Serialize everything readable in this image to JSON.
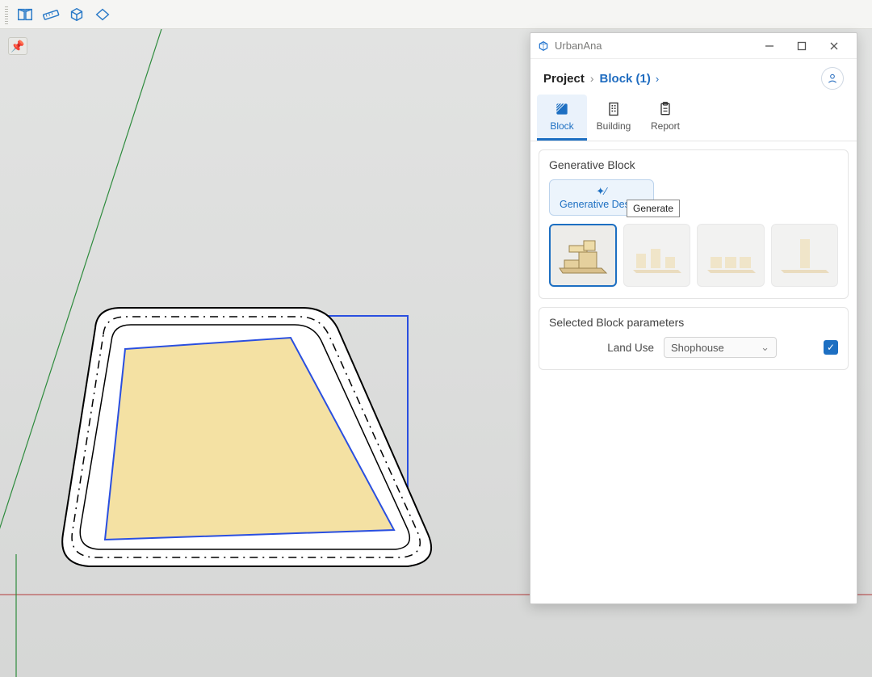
{
  "app": {
    "name": "UrbanAna"
  },
  "breadcrumbs": {
    "project": "Project",
    "block": "Block (1)"
  },
  "tabs": {
    "block": "Block",
    "building": "Building",
    "report": "Report",
    "active": "block"
  },
  "generative": {
    "section_title": "Generative Block",
    "button_label": "Generative Design",
    "tooltip": "Generate"
  },
  "params": {
    "section_title": "Selected Block parameters",
    "land_use_label": "Land Use",
    "land_use_value": "Shophouse",
    "checked": true
  },
  "toolbar_icons": [
    "book-open",
    "ruler",
    "box-3d",
    "diamond"
  ],
  "preset_names": [
    "preset-courtyard",
    "preset-scattered",
    "preset-row",
    "preset-tower"
  ]
}
